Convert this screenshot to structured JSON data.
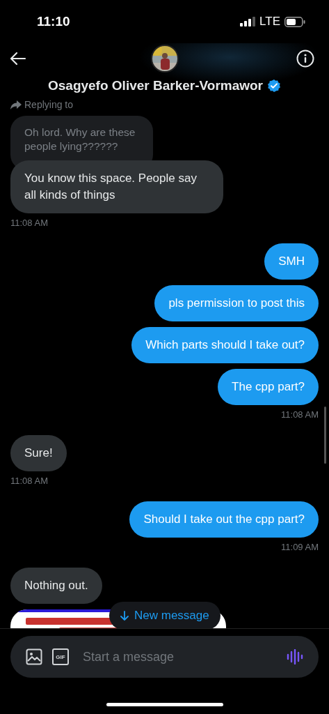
{
  "status_bar": {
    "time": "11:10",
    "network": "LTE"
  },
  "header": {
    "name": "Osagyefo Oliver Barker-Vormawor",
    "verified": true
  },
  "reply_context": {
    "label": "Replying to",
    "quoted_text": "Oh lord. Why are these people lying??????"
  },
  "messages": [
    {
      "kind": "incoming",
      "text": "You know this space. People say all kinds of things"
    },
    {
      "kind": "received_time",
      "text": "11:08 AM"
    },
    {
      "kind": "outgoing",
      "text": "SMH"
    },
    {
      "kind": "outgoing",
      "text": "pls permission to post this"
    },
    {
      "kind": "outgoing",
      "text": "Which parts should I take out?"
    },
    {
      "kind": "outgoing",
      "text": "The cpp part?"
    },
    {
      "kind": "sent_time",
      "text": "11:08 AM"
    },
    {
      "kind": "incoming",
      "text": "Sure!"
    },
    {
      "kind": "received_time",
      "text": "11:08 AM"
    },
    {
      "kind": "outgoing",
      "text": "Should I take out the cpp part?"
    },
    {
      "kind": "sent_time",
      "text": "11:09 AM"
    },
    {
      "kind": "incoming",
      "text": "Nothing out."
    },
    {
      "kind": "picture"
    }
  ],
  "new_message_pill": {
    "label": "New message"
  },
  "composer": {
    "gif_label": "GIF",
    "placeholder": "Start a message"
  }
}
